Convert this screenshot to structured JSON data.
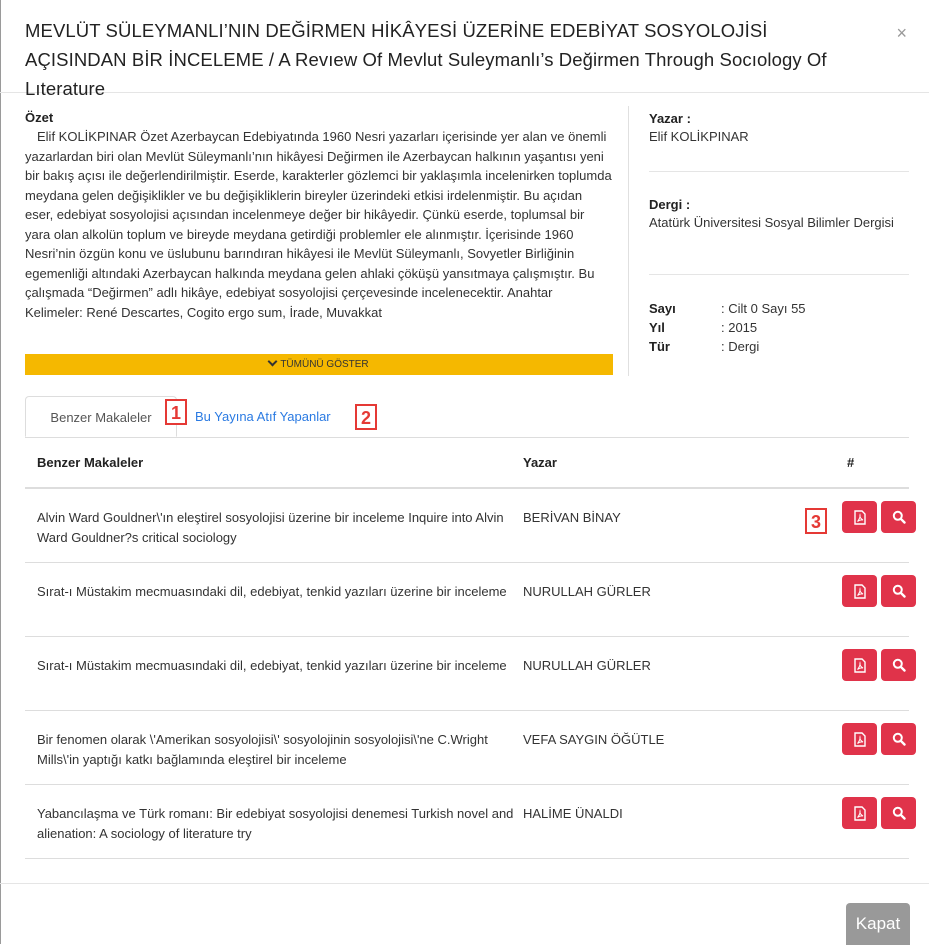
{
  "title": "MEVLÜT SÜLEYMANLI’NIN DEĞİRMEN HİKÂYESİ ÜZERİNE EDEBİYAT SOSYOLOJİSİ AÇISINDAN BİR İNCELEME / A Revıew Of Mevlut Suleymanlı’s Değirmen Through Socıology Of Lıterature",
  "close_glyph": "×",
  "abstract": {
    "label": "Özet",
    "text": "Elif KOLİKPINAR Özet Azerbaycan Edebiyatında 1960 Nesri yazarları içerisinde yer alan ve önemli yazarlardan biri olan Mevlüt Süleymanlı’nın hikâyesi Değirmen ile Azerbaycan halkının yaşantısı yeni bir bakış açısı ile değerlendirilmiştir. Eserde, karakterler gözlemci bir yaklaşımla incelenirken toplumda meydana gelen değişiklikler ve bu değişikliklerin bireyler üzerindeki etkisi irdelenmiştir. Bu açıdan eser, edebiyat sosyolojisi açısından incelenmeye değer bir hikâyedir. Çünkü eserde, toplumsal bir yara olan alkolün toplum ve bireyde meydana getirdiği problemler ele alınmıştır. İçerisinde 1960 Nesri’nin özgün konu ve üslubunu barındıran hikâyesi ile Mevlüt Süleymanlı, Sovyetler Birliğinin egemenliği altındaki Azerbaycan halkında meydana gelen ahlaki çöküşü yansıtmaya çalışmıştır. Bu çalışmada “Değirmen” adlı hikâye, edebiyat sosyolojisi çerçevesinde incelenecektir. Anahtar Kelimeler: René Descartes, Cogito ergo sum, İrade, Muvakkat",
    "show_all_label": "TÜMÜNÜ GÖSTER"
  },
  "meta": {
    "author_label": "Yazar :",
    "author": "Elif KOLİKPINAR",
    "journal_label": "Dergi :",
    "journal": "Atatürk Üniversitesi Sosyal Bilimler Dergisi",
    "issue_label": "Sayı",
    "issue": ": Cilt 0 Sayı 55",
    "year_label": "Yıl",
    "year": ": 2015",
    "type_label": "Tür",
    "type": ": Dergi"
  },
  "tabs": [
    {
      "label": "Benzer Makaleler",
      "active": true
    },
    {
      "label": "Bu Yayına Atıf Yapanlar",
      "active": false
    }
  ],
  "badges": [
    "1",
    "2",
    "3"
  ],
  "table": {
    "headers": [
      "Benzer Makaleler",
      "Yazar",
      "#"
    ],
    "rows": [
      {
        "title": "Alvin Ward Gouldner\\'ın eleştirel sosyolojisi üzerine bir inceleme Inquire into Alvin Ward Gouldner?s critical sociology",
        "author": "BERİVAN BİNAY"
      },
      {
        "title": "Sırat-ı Müstakim mecmuasındaki dil, edebiyat, tenkid yazıları üzerine bir inceleme",
        "author": "NURULLAH GÜRLER"
      },
      {
        "title": "Sırat-ı Müstakim mecmuasındaki dil, edebiyat, tenkid yazıları üzerine bir inceleme",
        "author": "NURULLAH GÜRLER"
      },
      {
        "title": "Bir fenomen olarak \\'Amerikan sosyolojisi\\' sosyolojinin sosyolojisi\\'ne C.Wright Mills\\'in yaptığı katkı bağlamında eleştirel bir inceleme",
        "author": "VEFA SAYGIN ÖĞÜTLE"
      },
      {
        "title": "Yabancılaşma ve Türk romanı: Bir edebiyat sosyolojisi denemesi Turkish novel and alienation: A sociology of literature try",
        "author": "HALİME ÜNALDI"
      }
    ]
  },
  "footer": {
    "close_label": "Kapat"
  },
  "colors": {
    "accent_yellow": "#f5b800",
    "action_red": "#e0334a",
    "link_blue": "#2a7ae2",
    "badge_red": "#e53935",
    "close_gray": "#999999"
  },
  "icons": {
    "pdf": "file-pdf-icon",
    "view": "search-icon",
    "chevron": "chevron-down-icon",
    "close": "close-icon"
  }
}
